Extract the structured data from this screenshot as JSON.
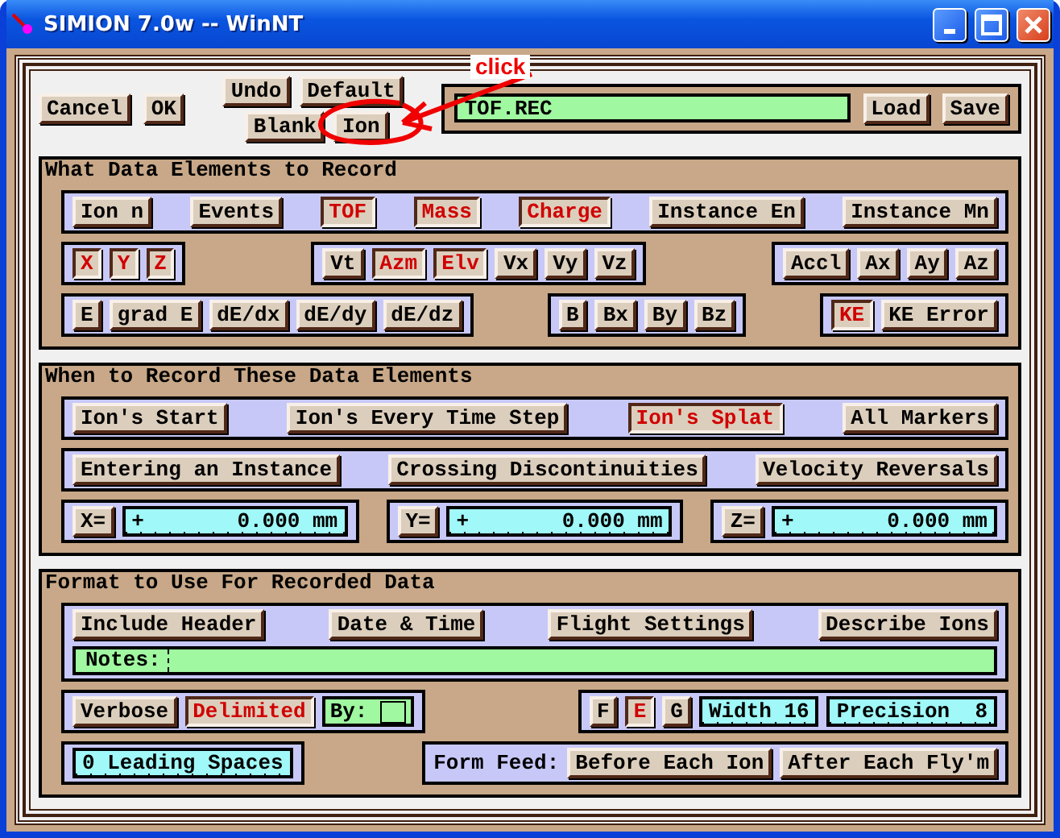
{
  "window": {
    "title": "SIMION 7.0w -- WinNT"
  },
  "annotation": {
    "text": "click"
  },
  "toolbar": {
    "dialog_buttons": [
      "Cancel",
      "OK"
    ],
    "edit_buttons": [
      [
        "Undo",
        "Default"
      ],
      [
        "Blank",
        "Ion"
      ]
    ],
    "file": {
      "value": "TOF.REC"
    },
    "file_buttons": [
      "Load",
      "Save"
    ]
  },
  "sections": [
    {
      "title": "What Data Elements to Record",
      "rows": [
        [
          {
            "items": [
              {
                "kind": "toggle",
                "label": "Ion n",
                "selected": false
              },
              {
                "kind": "toggle",
                "label": "Events",
                "selected": false
              },
              {
                "kind": "toggle",
                "label": "TOF",
                "selected": true
              },
              {
                "kind": "toggle",
                "label": "Mass",
                "selected": true
              },
              {
                "kind": "toggle",
                "label": "Charge",
                "selected": true
              },
              {
                "kind": "toggle",
                "label": "Instance En",
                "selected": false
              },
              {
                "kind": "toggle",
                "label": "Instance Mn",
                "selected": false
              }
            ]
          }
        ],
        [
          {
            "items": [
              {
                "kind": "toggle",
                "label": "X",
                "selected": true
              },
              {
                "kind": "toggle",
                "label": "Y",
                "selected": true
              },
              {
                "kind": "toggle",
                "label": "Z",
                "selected": true
              }
            ]
          },
          {
            "items": [
              {
                "kind": "toggle",
                "label": "Vt",
                "selected": false
              },
              {
                "kind": "toggle",
                "label": "Azm",
                "selected": true
              },
              {
                "kind": "toggle",
                "label": "Elv",
                "selected": true
              },
              {
                "kind": "toggle",
                "label": "Vx",
                "selected": false
              },
              {
                "kind": "toggle",
                "label": "Vy",
                "selected": false
              },
              {
                "kind": "toggle",
                "label": "Vz",
                "selected": false
              }
            ]
          },
          {
            "items": [
              {
                "kind": "toggle",
                "label": "Accl",
                "selected": false
              },
              {
                "kind": "toggle",
                "label": "Ax",
                "selected": false
              },
              {
                "kind": "toggle",
                "label": "Ay",
                "selected": false
              },
              {
                "kind": "toggle",
                "label": "Az",
                "selected": false
              }
            ]
          }
        ],
        [
          {
            "items": [
              {
                "kind": "toggle",
                "label": "E",
                "selected": false
              },
              {
                "kind": "toggle",
                "label": "grad E",
                "selected": false
              },
              {
                "kind": "toggle",
                "label": "dE/dx",
                "selected": false
              },
              {
                "kind": "toggle",
                "label": "dE/dy",
                "selected": false
              },
              {
                "kind": "toggle",
                "label": "dE/dz",
                "selected": false
              }
            ]
          },
          {
            "items": [
              {
                "kind": "toggle",
                "label": "B",
                "selected": false
              },
              {
                "kind": "toggle",
                "label": "Bx",
                "selected": false
              },
              {
                "kind": "toggle",
                "label": "By",
                "selected": false
              },
              {
                "kind": "toggle",
                "label": "Bz",
                "selected": false
              }
            ]
          },
          {
            "items": [
              {
                "kind": "toggle",
                "label": "KE",
                "selected": true
              },
              {
                "kind": "toggle",
                "label": "KE Error",
                "selected": false
              }
            ]
          }
        ]
      ]
    },
    {
      "title": "When to Record These Data Elements",
      "rows": [
        [
          {
            "items": [
              {
                "kind": "toggle",
                "label": "Ion's Start",
                "selected": false
              },
              {
                "kind": "toggle",
                "label": "Ion's Every Time Step",
                "selected": false
              },
              {
                "kind": "toggle",
                "label": "Ion's Splat",
                "selected": true
              },
              {
                "kind": "toggle",
                "label": "All Markers",
                "selected": false
              }
            ]
          }
        ],
        [
          {
            "items": [
              {
                "kind": "toggle",
                "label": "Entering an Instance",
                "selected": false
              },
              {
                "kind": "toggle",
                "label": "Crossing Discontinuities",
                "selected": false
              },
              {
                "kind": "toggle",
                "label": "Velocity Reversals",
                "selected": false
              }
            ]
          }
        ],
        [
          {
            "items": [
              {
                "kind": "button",
                "label": "X="
              },
              {
                "kind": "coordinate",
                "sign": "+",
                "value": "0.000 mm"
              }
            ]
          },
          {
            "items": [
              {
                "kind": "button",
                "label": "Y="
              },
              {
                "kind": "coordinate",
                "sign": "+",
                "value": "0.000 mm"
              }
            ]
          },
          {
            "items": [
              {
                "kind": "button",
                "label": "Z="
              },
              {
                "kind": "coordinate",
                "sign": "+",
                "value": "0.000 mm"
              }
            ]
          }
        ]
      ]
    },
    {
      "title": "Format to Use For Recorded Data",
      "rows": [
        [
          {
            "items": [
              {
                "kind": "toggle",
                "label": "Include Header",
                "selected": false
              },
              {
                "kind": "toggle",
                "label": "Date & Time",
                "selected": false
              },
              {
                "kind": "toggle",
                "label": "Flight Settings",
                "selected": false
              },
              {
                "kind": "toggle",
                "label": "Describe Ions",
                "selected": false
              },
              {
                "kind": "notes",
                "label": "Notes:"
              }
            ]
          }
        ],
        [
          {
            "items": [
              {
                "kind": "toggle",
                "label": "Verbose",
                "selected": false
              },
              {
                "kind": "toggle",
                "label": "Delimited",
                "selected": true
              },
              {
                "kind": "delimiter",
                "label": "By:"
              }
            ]
          },
          {
            "items": [
              {
                "kind": "toggle",
                "label": "F",
                "selected": false
              },
              {
                "kind": "toggle",
                "label": "E",
                "selected": true
              },
              {
                "kind": "toggle",
                "label": "G",
                "selected": false
              },
              {
                "kind": "readout",
                "text": "Width 16"
              },
              {
                "kind": "readout",
                "text": "Precision  8"
              }
            ]
          }
        ],
        [
          {
            "items": [
              {
                "kind": "readout",
                "text": "0 Leading Spaces"
              }
            ]
          },
          {
            "items": [
              {
                "kind": "label",
                "text": "Form Feed:"
              },
              {
                "kind": "toggle",
                "label": "Before Each Ion",
                "selected": false
              },
              {
                "kind": "toggle",
                "label": "After Each Fly'm",
                "selected": false
              }
            ]
          }
        ]
      ]
    }
  ]
}
